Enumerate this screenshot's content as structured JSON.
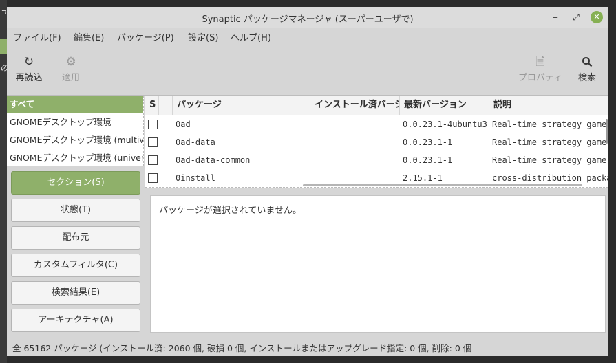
{
  "desktop": {
    "glyph_top": "ュ",
    "glyph_mid": "の"
  },
  "window": {
    "title": "Synaptic パッケージマネージャ  (スーパーユーザで)",
    "minimize": "‒",
    "restore": "⤢",
    "close": "✕"
  },
  "menu": [
    "ファイル(F)",
    "編集(E)",
    "パッケージ(P)",
    "設定(S)",
    "ヘルプ(H)"
  ],
  "toolbar": {
    "reload": {
      "label": "再読込",
      "icon": "reload-icon"
    },
    "apply": {
      "label": "適用",
      "icon": "apply-icon"
    },
    "properties": {
      "label": "プロパティ",
      "icon": "properties-icon"
    },
    "search": {
      "label": "検索",
      "icon": "search-icon"
    }
  },
  "categories": [
    "すべて",
    "GNOMEデスクトップ環境",
    "GNOMEデスクトップ環境 (multiverse)",
    "GNOMEデスクトップ環境 (universe)"
  ],
  "filter_buttons": [
    "セクション(S)",
    "状態(T)",
    "配布元",
    "カスタムフィルタ(C)",
    "検索結果(E)",
    "アーキテクチャ(A)"
  ],
  "table": {
    "columns": [
      "S",
      "",
      "パッケージ",
      "インストール済バージョン",
      "最新バージョン",
      "説明"
    ],
    "rows": [
      {
        "package": "0ad",
        "installed": "",
        "latest": "0.0.23.1-4ubuntu3",
        "description": "Real-time strategy game of ancient warfare"
      },
      {
        "package": "0ad-data",
        "installed": "",
        "latest": "0.0.23.1-1",
        "description": "Real-time strategy game of ancient warfare (data files)"
      },
      {
        "package": "0ad-data-common",
        "installed": "",
        "latest": "0.0.23.1-1",
        "description": "Real-time strategy game of ancient warfare (common data files)"
      },
      {
        "package": "0install",
        "installed": "",
        "latest": "2.15.1-1",
        "description": "cross-distribution packaging system"
      }
    ]
  },
  "details": {
    "empty_message": "パッケージが選択されていません。"
  },
  "status_bar": "全 65162 パッケージ (インストール済: 2060 個, 破損 0 個, インストールまたはアップグレード指定: 0 個, 削除: 0 個"
}
